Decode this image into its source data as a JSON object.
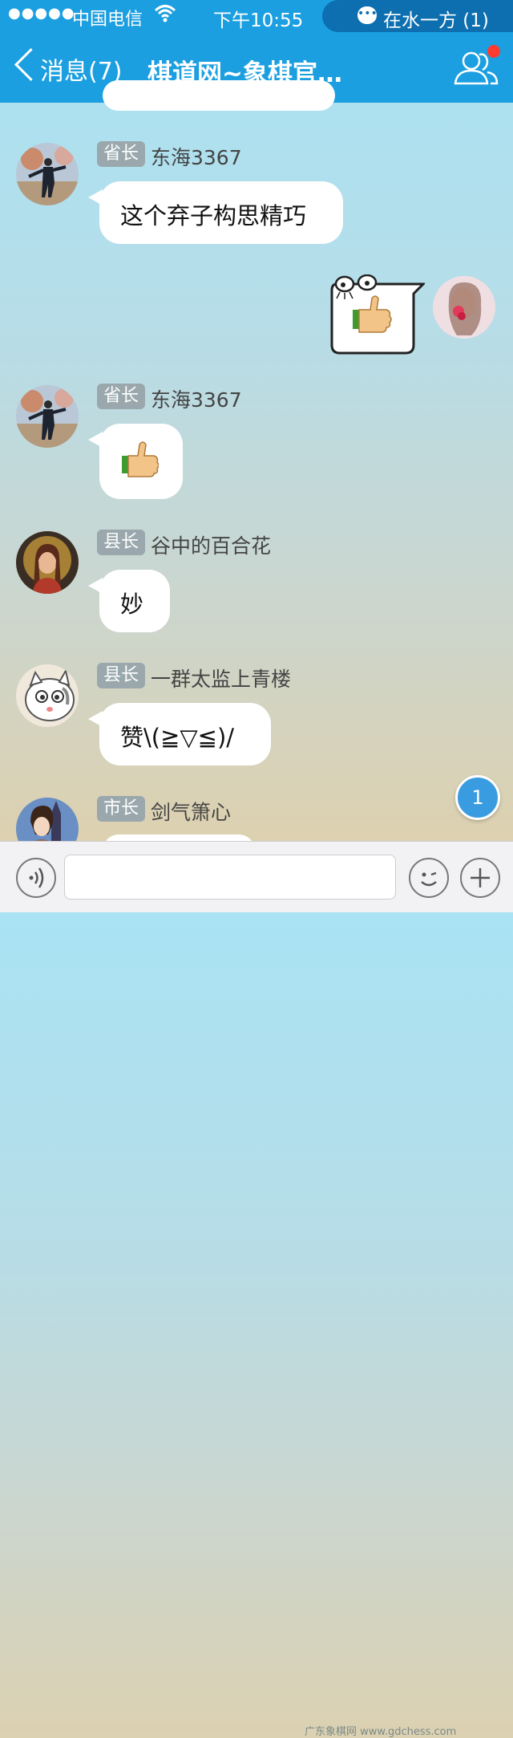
{
  "status_bar": {
    "signal": "●●●●●",
    "carrier": "中国电信",
    "time": "下午10:55",
    "notification_text": "在水一方 (1)"
  },
  "nav": {
    "back_label": "消息(7)",
    "title": "棋道网~象棋官…"
  },
  "messages": [
    {
      "rank": "省长",
      "sender": "东海3367",
      "text": "这个弃子构思精巧"
    },
    {
      "type": "own_sticker",
      "icon": "thumbs-up-sticker-icon"
    },
    {
      "rank": "省长",
      "sender": "东海3367",
      "icon": "thumbs-up-icon"
    },
    {
      "rank": "县长",
      "sender": "谷中的百合花",
      "text": "妙"
    },
    {
      "rank": "县长",
      "sender": "一群太监上青楼",
      "text": "赞\\(≧▽≦)/"
    },
    {
      "rank": "市长",
      "sender": "剑气箫心"
    }
  ],
  "unread_badge": "1",
  "input": {
    "placeholder": ""
  },
  "watermark": "广东象棋网 www.gdchess.com",
  "colors": {
    "header": "#1b9fe0",
    "status_pill": "#0d6fb0",
    "rank_badge": "#9aa8ad"
  }
}
